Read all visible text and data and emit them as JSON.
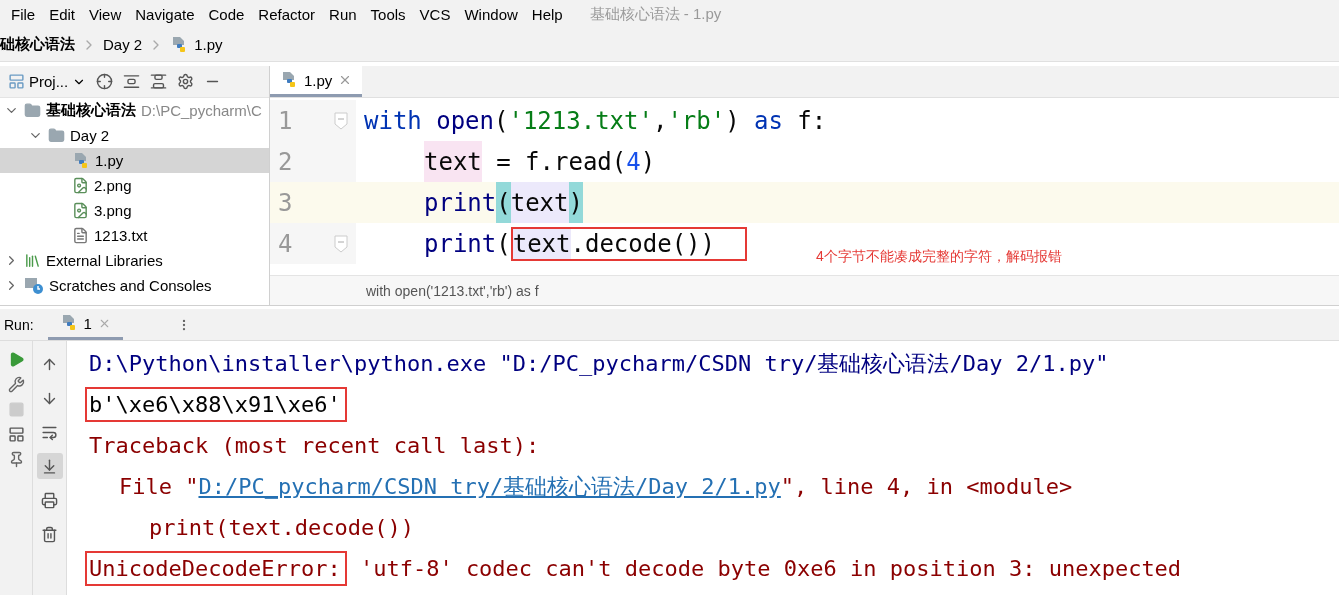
{
  "window": {
    "title": "基础核心语法 - 1.py"
  },
  "menu": [
    "File",
    "Edit",
    "View",
    "Navigate",
    "Code",
    "Refactor",
    "Run",
    "Tools",
    "VCS",
    "Window",
    "Help"
  ],
  "breadcrumb": [
    {
      "label": "础核心语法",
      "kind": "folder"
    },
    {
      "label": "Day 2",
      "kind": "folder"
    },
    {
      "label": "1.py",
      "kind": "python"
    }
  ],
  "project": {
    "view_label": "Proj...",
    "tree": [
      {
        "label": "基础核心语法",
        "hint": "D:\\PC_pycharm\\C",
        "kind": "folder",
        "expanded": true,
        "selected": false,
        "children": [
          {
            "label": "Day 2",
            "kind": "folder",
            "expanded": true,
            "selected": false,
            "children": [
              {
                "label": "1.py",
                "kind": "python",
                "selected": true
              },
              {
                "label": "2.png",
                "kind": "image",
                "selected": false
              },
              {
                "label": "3.png",
                "kind": "image",
                "selected": false
              },
              {
                "label": "1213.txt",
                "kind": "text",
                "selected": false
              }
            ]
          }
        ]
      },
      {
        "label": "External Libraries",
        "kind": "library",
        "expanded": false,
        "selected": false
      },
      {
        "label": "Scratches and Consoles",
        "kind": "scratches",
        "expanded": false,
        "selected": false
      }
    ]
  },
  "editor": {
    "tabs": [
      {
        "label": "1.py",
        "selected": true
      }
    ],
    "lines": [
      {
        "number": "1",
        "current": false,
        "fold": true,
        "tokens": [
          {
            "text": "with",
            "kind": "keyword"
          },
          {
            "text": "open",
            "kind": "builtin",
            "spaced": true
          },
          {
            "text": "("
          },
          {
            "text": "'1213.txt'",
            "kind": "string"
          },
          {
            "text": ","
          },
          {
            "text": "'rb'",
            "kind": "string"
          },
          {
            "text": ")"
          },
          {
            "text": "as",
            "kind": "keyword",
            "spaced": true
          },
          {
            "text": "f:",
            "spaced": true
          }
        ],
        "children": [
          {
            "number": "2",
            "current": false,
            "fold": false,
            "tokens": [
              {
                "text": "text",
                "kind": "write-usage"
              },
              {
                "text": "= f.read(",
                "spaced": true
              },
              {
                "text": "4",
                "kind": "number"
              },
              {
                "text": ")"
              }
            ]
          },
          {
            "number": "3",
            "current": true,
            "fold": false,
            "tokens": [
              {
                "text": "print",
                "kind": "builtin"
              },
              {
                "text": "(",
                "kind": "brace-match"
              },
              {
                "text": "text",
                "kind": "read-usage"
              },
              {
                "text": ")",
                "kind": "brace-match"
              }
            ]
          },
          {
            "number": "4",
            "current": false,
            "fold": true,
            "tokens": [
              {
                "text": "print",
                "kind": "builtin"
              },
              {
                "text": "("
              },
              {
                "text": "text",
                "kind": "read-usage",
                "boxed": true
              },
              {
                "text": ".decode())",
                "boxed": true
              }
            ]
          }
        ]
      }
    ],
    "note": "4个字节不能凑成完整的字符，解码报错",
    "path": "with open('1213.txt','rb') as f"
  },
  "run": {
    "label": "Run:",
    "tabs": [
      {
        "label": "1",
        "selected": true
      }
    ],
    "tools": [
      {
        "kind": "up",
        "selected": false
      },
      {
        "kind": "down",
        "selected": false
      },
      {
        "kind": "wrap",
        "selected": false
      },
      {
        "kind": "scroll-end",
        "selected": true
      },
      {
        "kind": "print",
        "selected": false
      },
      {
        "kind": "trash",
        "selected": false
      }
    ],
    "console": [
      {
        "segments": [
          {
            "text": "D:\\Python\\installer\\python.exe \"D:/PC_pycharm/CSDN try/基础核心语法/Day 2/1.py\"",
            "kind": "command"
          }
        ]
      },
      {
        "segments": [
          {
            "text": "b'\\xe6\\x88\\x91\\xe6'",
            "kind": "output",
            "boxed": true
          }
        ]
      },
      {
        "segments": [
          {
            "text": "Traceback (most recent call last):",
            "kind": "error"
          }
        ],
        "children": [
          {
            "segments": [
              {
                "text": "File \"",
                "kind": "error"
              },
              {
                "text": "D:/PC_pycharm/CSDN try/基础核心语法/Day 2/1.py",
                "kind": "link"
              },
              {
                "text": "\", line 4, in <module>",
                "kind": "error"
              }
            ],
            "children": [
              {
                "segments": [
                  {
                    "text": "print(text.decode())",
                    "kind": "error"
                  }
                ]
              }
            ]
          }
        ]
      },
      {
        "segments": [
          {
            "text": "UnicodeDecodeError:",
            "kind": "error",
            "boxed": true
          },
          {
            "text": " 'utf-8' codec can't decode byte 0xe6 in position 3: unexpected",
            "kind": "error"
          }
        ]
      }
    ]
  }
}
